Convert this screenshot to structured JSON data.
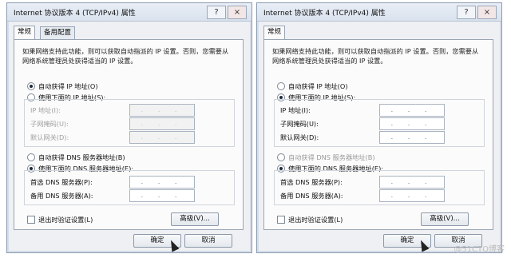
{
  "left": {
    "title": "Internet 协议版本 4 (TCP/IPv4) 属性",
    "help_label": "?",
    "close_label": "×",
    "tabs": [
      "常规",
      "备用配置"
    ],
    "description": "如果网络支持此功能，则可以获取自动指派的 IP 设置。否则，您需要从网络系统管理员处获得适当的 IP 设置。",
    "ip_auto": "自动获得 IP 地址(O)",
    "ip_manual": "使用下面的 IP 地址(S):",
    "ip_label": "IP 地址(I):",
    "mask_label": "子网掩码(U):",
    "gateway_label": "默认网关(D):",
    "ip_box": ". . .",
    "dns_auto": "自动获得 DNS 服务器地址(B)",
    "dns_manual": "使用下面的 DNS 服务器地址(E):",
    "dns_pref_label": "首选 DNS 服务器(P):",
    "dns_alt_label": "备用 DNS 服务器(A):",
    "validate_label": "退出时验证设置(L)",
    "advanced_label": "高级(V)...",
    "ok_label": "确定",
    "cancel_label": "取消"
  },
  "right": {
    "title": "Internet 协议版本 4 (TCP/IPv4) 属性",
    "help_label": "?",
    "close_label": "×",
    "tabs": [
      "常规"
    ],
    "description": "如果网络支持此功能，则可以获取自动指派的 IP 设置。否则，您需要从网络系统管理员处获得适当的 IP 设置。",
    "ip_auto": "自动获得 IP 地址(O)",
    "ip_manual": "使用下面的 IP 地址(S):",
    "ip_label": "IP 地址(I):",
    "mask_label": "子网掩码(U):",
    "gateway_label": "默认网关(D):",
    "ip_box": ". . .",
    "dns_auto": "自动获得 DNS 服务器地址(B)",
    "dns_manual": "使用下面的 DNS 服务器地址(E):",
    "dns_pref_label": "首选 DNS 服务器(P):",
    "dns_alt_label": "备用 DNS 服务器(A):",
    "validate_label": "退出时验证设置(L)",
    "advanced_label": "高级(V)...",
    "ok_label": "确定",
    "cancel_label": "取消"
  },
  "watermark": "@51CTO博客"
}
